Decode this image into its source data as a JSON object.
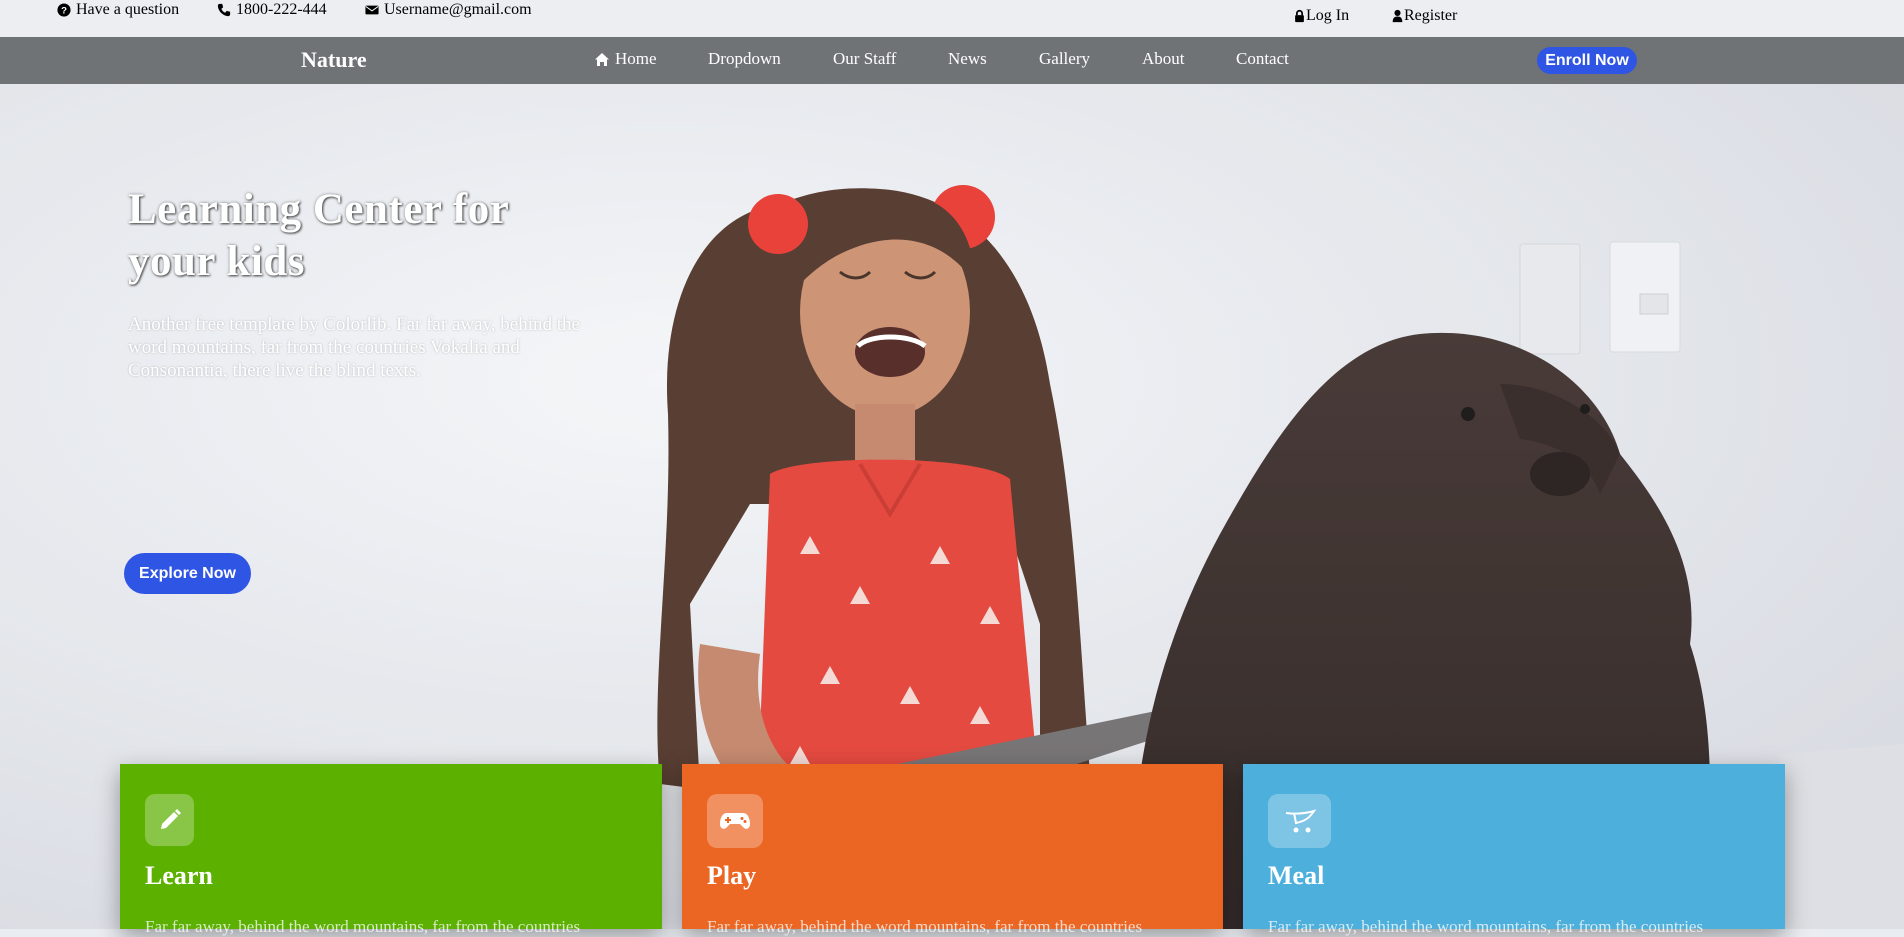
{
  "topbar": {
    "question": "Have a question",
    "phone": "1800-222-444",
    "email": "Username@gmail.com",
    "login": "Log In",
    "register": "Register"
  },
  "navbar": {
    "brand": "Nature",
    "links": [
      "Home",
      "Dropdown",
      "Our Staff",
      "News",
      "Gallery",
      "About",
      "Contact"
    ],
    "enroll": "Enroll Now"
  },
  "hero": {
    "title": "Learning Center for your kids",
    "text": "Another free template by Colorlib. Far far away, behind the word mountains, far from the countries Vokalia and Consonantia, there live the blind texts.",
    "button": "Explore Now"
  },
  "cards": [
    {
      "title": "Learn",
      "text": "Far far away, behind the word mountains, far from the countries",
      "color": "#5cb100",
      "icon": "pencil-icon"
    },
    {
      "title": "Play",
      "text": "Far far away, behind the word mountains, far from the countries",
      "color": "#ec6623",
      "icon": "gamepad-icon"
    },
    {
      "title": "Meal",
      "text": "Far far away, behind the word mountains, far from the countries",
      "color": "#4dafdb",
      "icon": "cart-icon"
    }
  ],
  "colors": {
    "accent": "#2f55e4",
    "navbar": "#6f7376"
  }
}
